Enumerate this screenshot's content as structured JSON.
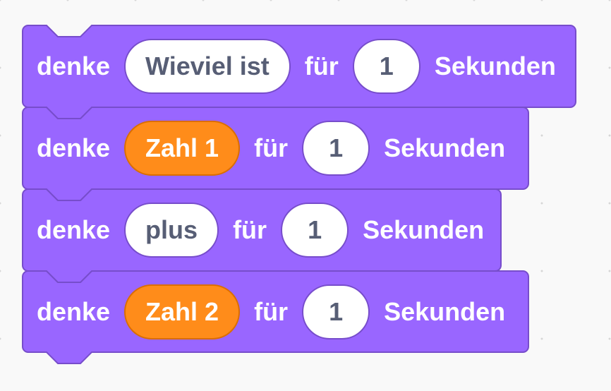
{
  "colors": {
    "block_fill": "#9966FF",
    "block_border": "#774DCB",
    "variable_fill": "#FF8C1A",
    "variable_border": "#DB6E00",
    "input_fill": "#FFFFFF",
    "input_text": "#575E75",
    "workspace_bg": "#F9F9F9"
  },
  "script": {
    "blocks": [
      {
        "opcode": "looks_thinkforsecs",
        "label_think": "denke",
        "message": {
          "kind": "text",
          "value": "Wieviel ist"
        },
        "label_for": "für",
        "seconds": "1",
        "label_unit": "Sekunden"
      },
      {
        "opcode": "looks_thinkforsecs",
        "label_think": "denke",
        "message": {
          "kind": "variable",
          "value": "Zahl 1"
        },
        "label_for": "für",
        "seconds": "1",
        "label_unit": "Sekunden"
      },
      {
        "opcode": "looks_thinkforsecs",
        "label_think": "denke",
        "message": {
          "kind": "text",
          "value": "plus"
        },
        "label_for": "für",
        "seconds": "1",
        "label_unit": "Sekunden"
      },
      {
        "opcode": "looks_thinkforsecs",
        "label_think": "denke",
        "message": {
          "kind": "variable",
          "value": "Zahl 2"
        },
        "label_for": "für",
        "seconds": "1",
        "label_unit": "Sekunden"
      }
    ]
  }
}
